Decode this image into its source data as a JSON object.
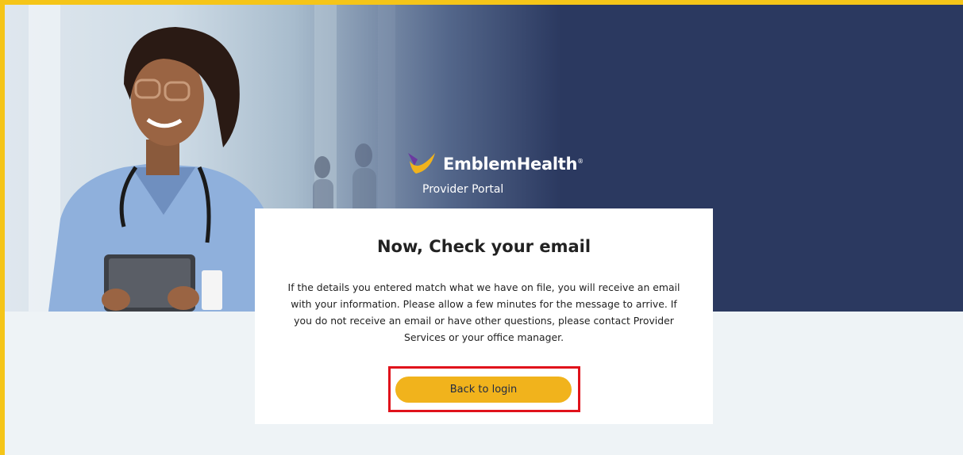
{
  "brand": {
    "name": "EmblemHealth",
    "reg_mark": "®",
    "subtitle": "Provider Portal"
  },
  "card": {
    "title": "Now, Check your email",
    "message": "If the details you entered match what we have on file, you will receive an email with your information. Please allow a few minutes for the message to arrive. If you do not receive an email or have other questions, please contact Provider Services or your office manager.",
    "back_button_label": "Back to login"
  },
  "colors": {
    "hero_navy": "#2b3960",
    "button_gold": "#f1b31c",
    "page_background": "#eef3f6",
    "highlight_red": "#e0121b",
    "frame_yellow": "#f5c518"
  }
}
